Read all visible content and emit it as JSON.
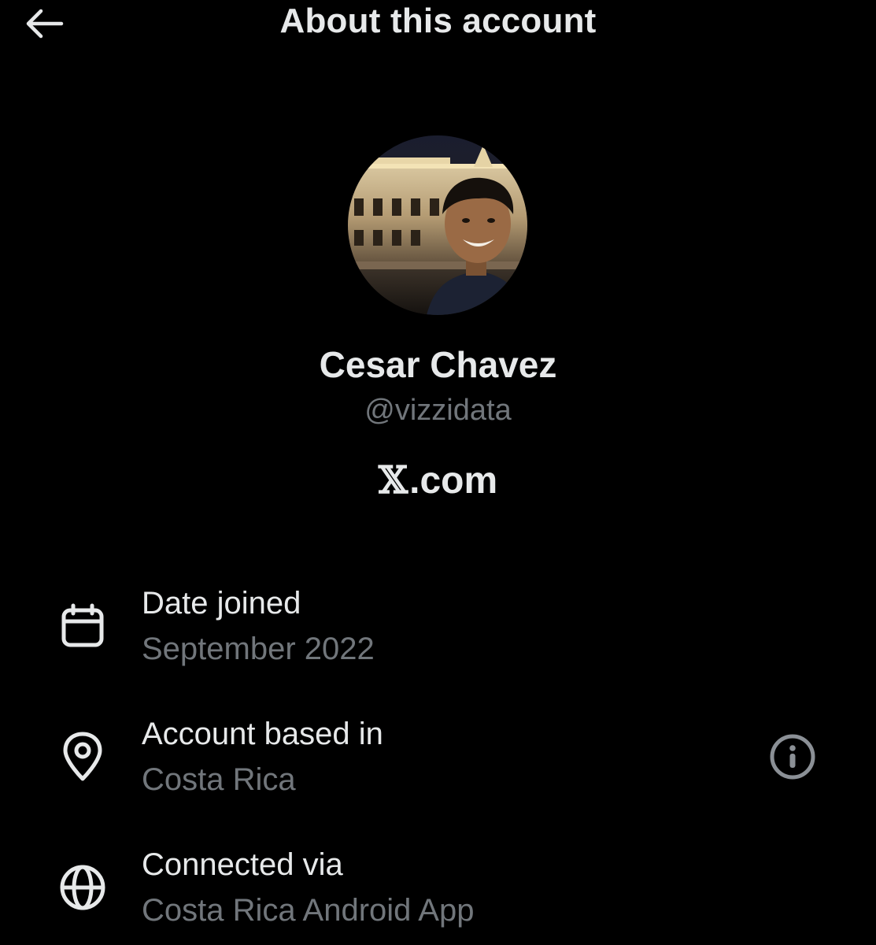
{
  "header": {
    "title": "About this account",
    "back_icon": "arrow-left-icon"
  },
  "profile": {
    "display_name": "Cesar Chavez",
    "handle": "@vizzidata",
    "site_logo": "𝕏",
    "site_suffix": ".com"
  },
  "details": [
    {
      "icon": "calendar-icon",
      "label": "Date joined",
      "value": "September 2022"
    },
    {
      "icon": "location-pin-icon",
      "label": "Account based in",
      "value": "Costa Rica",
      "action_icon": "info-icon"
    },
    {
      "icon": "globe-icon",
      "label": "Connected via",
      "value": "Costa Rica Android App"
    }
  ],
  "colors": {
    "background": "#000000",
    "primary_text": "#e7e9ea",
    "secondary_text": "#71767b"
  }
}
